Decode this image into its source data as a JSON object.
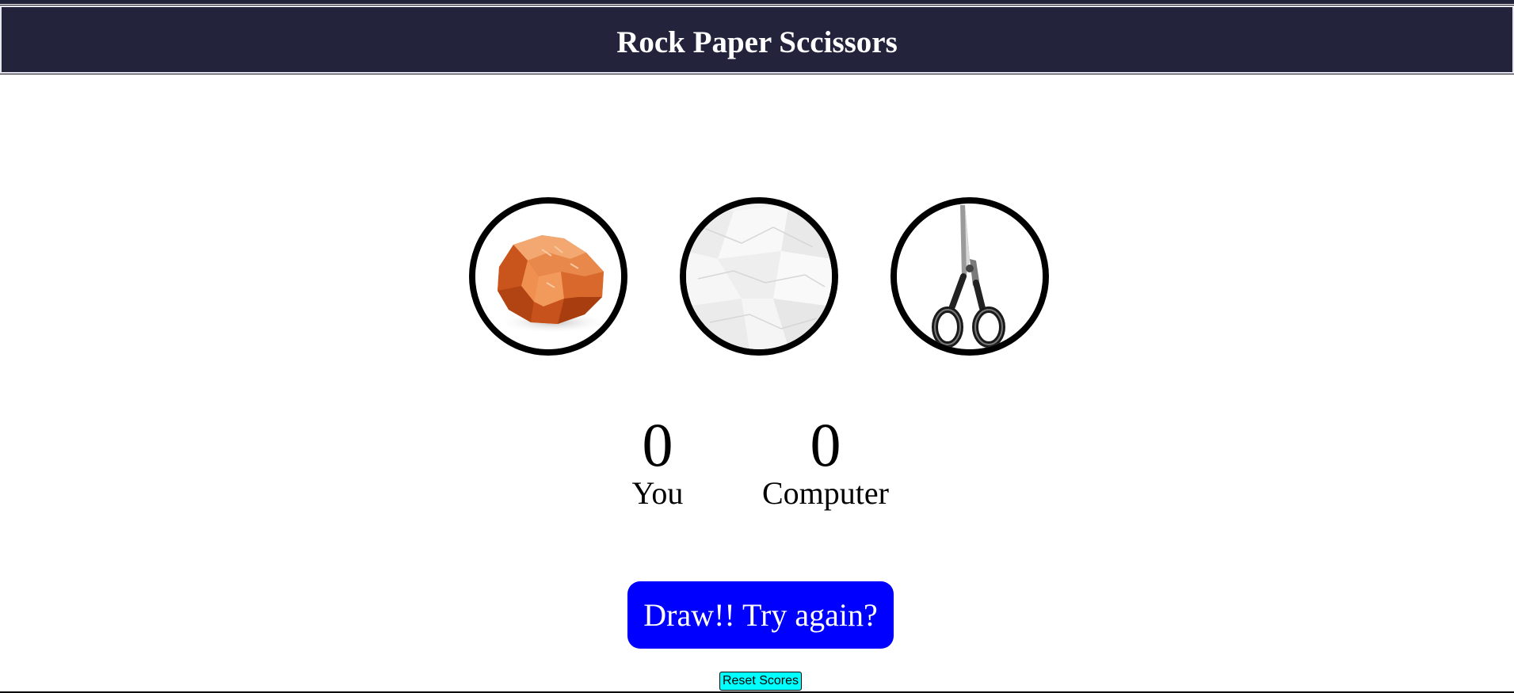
{
  "header": {
    "title": "Rock Paper Sccissors"
  },
  "colors": {
    "header_bg": "#23233b",
    "result_bg": "#0000ff",
    "reset_bg": "#00ffff"
  },
  "choices": [
    {
      "id": "rock",
      "icon": "rock-icon"
    },
    {
      "id": "paper",
      "icon": "paper-icon"
    },
    {
      "id": "scissors",
      "icon": "scissors-icon"
    }
  ],
  "scores": {
    "user": {
      "value": "0",
      "label": "You"
    },
    "computer": {
      "value": "0",
      "label": "Computer"
    }
  },
  "result": {
    "message": "Draw!! Try again?"
  },
  "reset": {
    "label": "Reset Scores"
  }
}
